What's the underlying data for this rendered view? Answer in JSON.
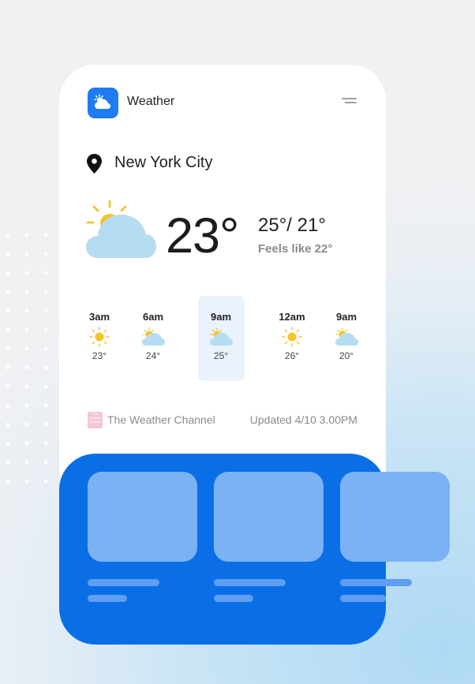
{
  "app": {
    "title": "Weather",
    "icon": "partly-cloudy-icon",
    "accent": "#1f7cf0"
  },
  "location": {
    "name": "New York City",
    "icon": "location-pin-icon"
  },
  "current": {
    "temp": "23°",
    "hilo": "25°/ 21°",
    "feels_like": "Feels like 22°",
    "icon": "partly-cloudy-icon"
  },
  "hourly": [
    {
      "time": "3am",
      "temp": "23°",
      "icon": "sun-icon"
    },
    {
      "time": "6am",
      "temp": "24°",
      "icon": "partly-cloudy-icon"
    },
    {
      "time": "9am",
      "temp": "25°",
      "icon": "partly-cloudy-icon",
      "selected": true
    },
    {
      "time": "12am",
      "temp": "26°",
      "icon": "sun-icon"
    },
    {
      "time": "9am",
      "temp": "20°",
      "icon": "partly-cloudy-icon"
    }
  ],
  "footer": {
    "source": "The Weather Channel",
    "updated": "Updated 4/10 3.00PM",
    "source_logo_text": "The Weather Channel"
  },
  "colors": {
    "panel": "#0a6ee6",
    "tile": "#7ab2f3",
    "sun": "#f6c32a",
    "cloud": "#b6dcf2"
  }
}
